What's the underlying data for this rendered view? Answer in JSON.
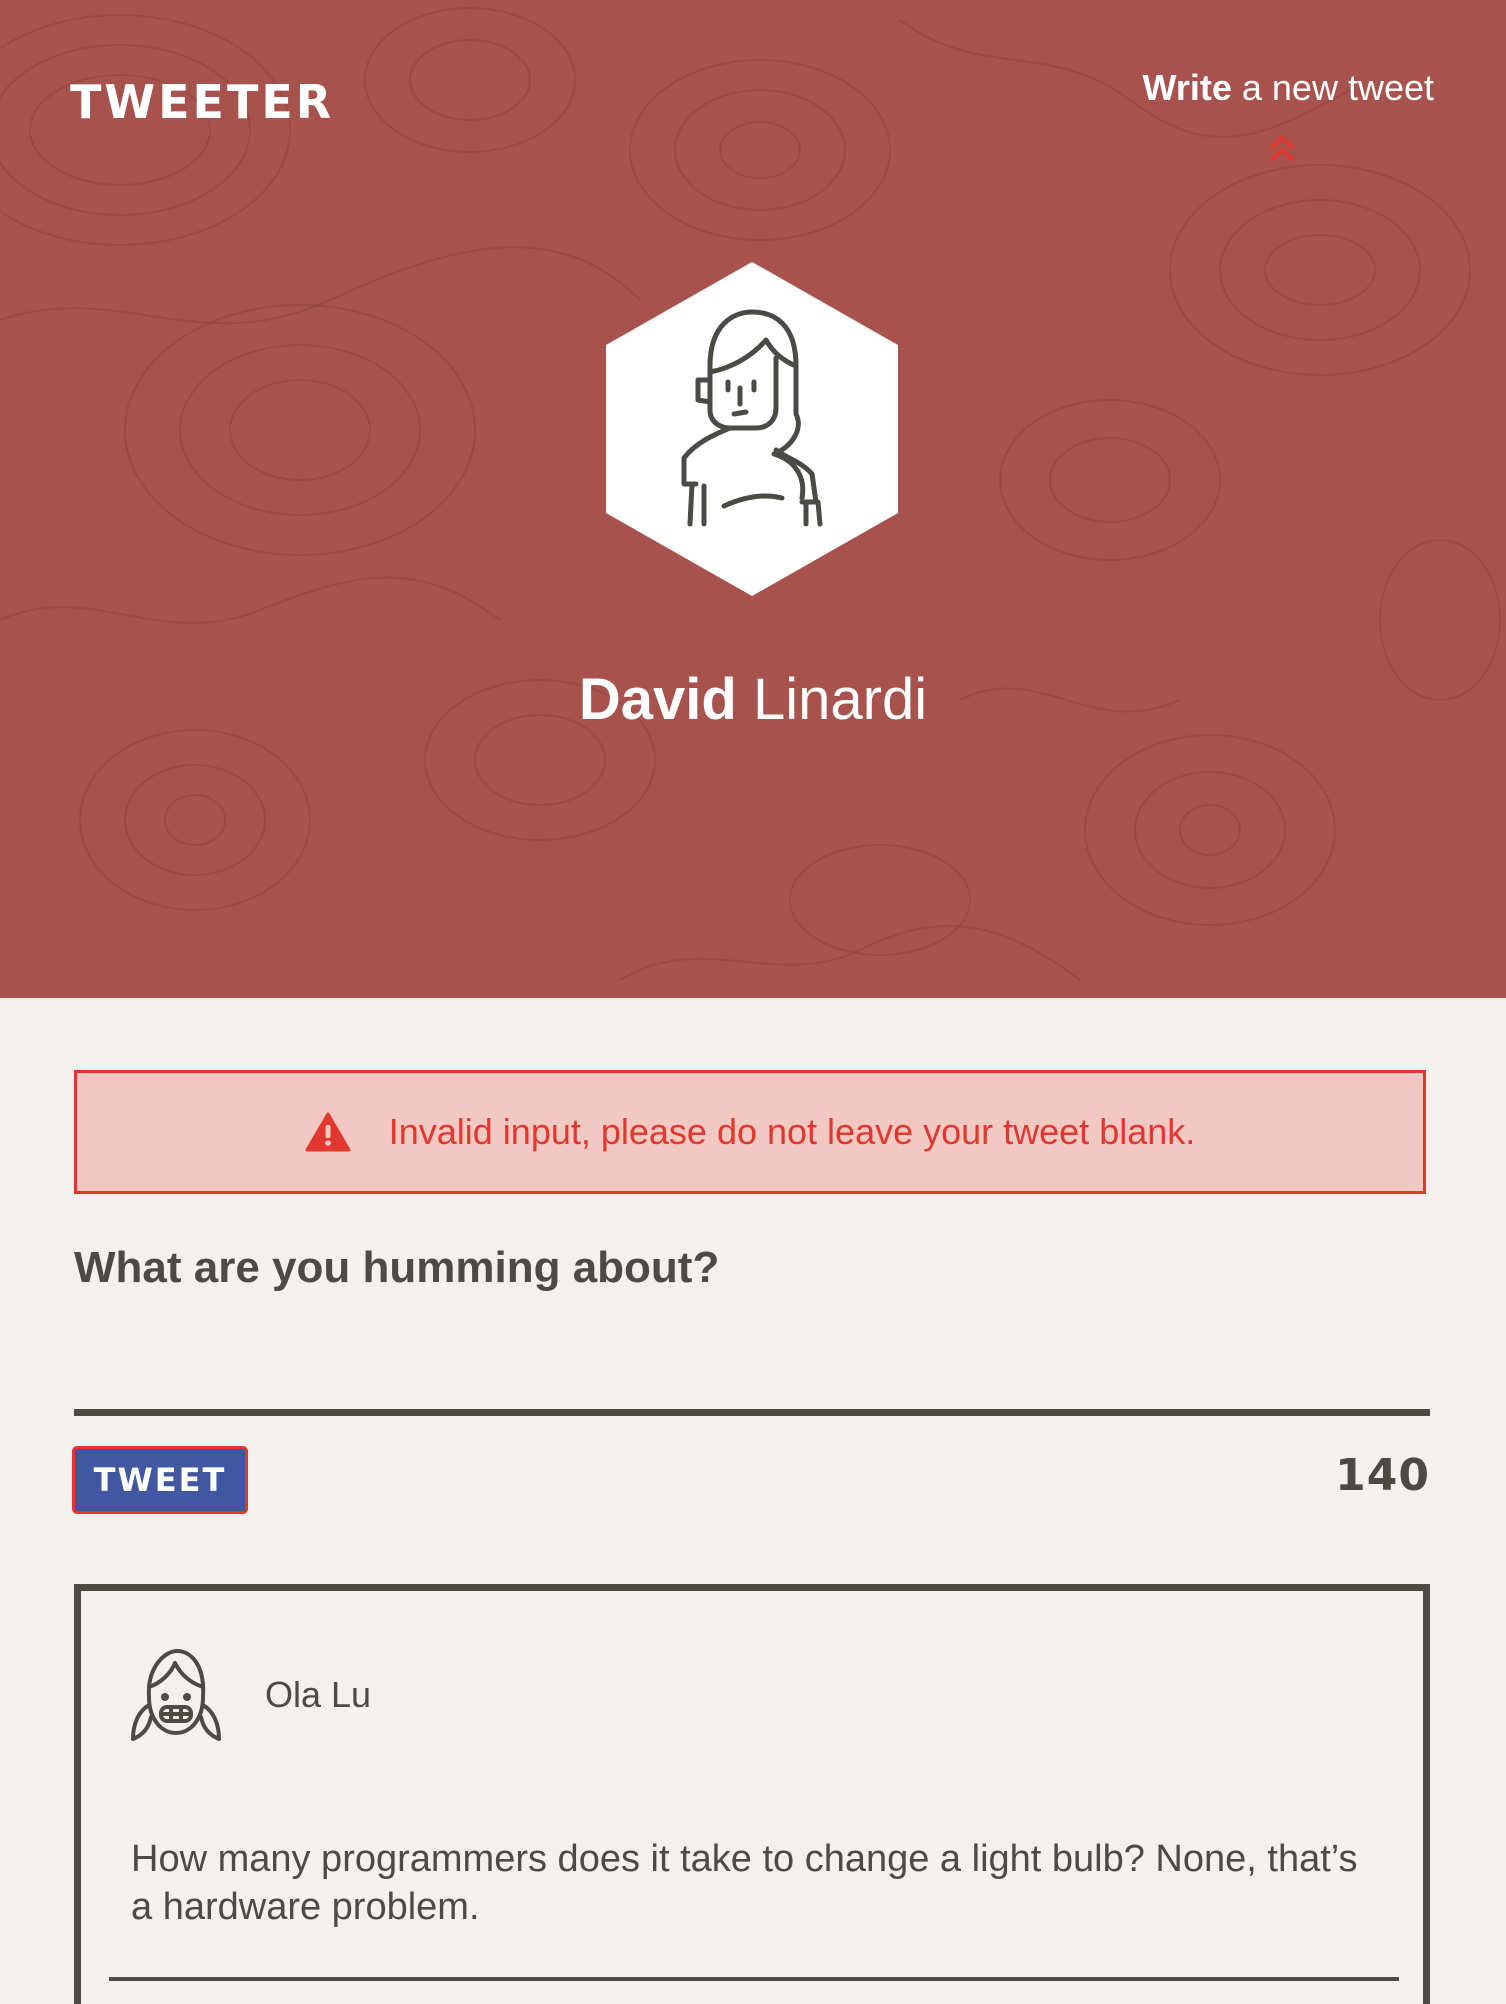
{
  "app": {
    "brand": "TWEETER",
    "compose_link": {
      "strong": "Write",
      "rest": " a new tweet"
    }
  },
  "profile": {
    "first_name": "David",
    "last_name": "Linardi",
    "avatar_icon": "woman-avatar-icon"
  },
  "alert": {
    "icon": "warning-icon",
    "message": "Invalid input, please do not leave your tweet blank."
  },
  "composer": {
    "label": "What are you humming about?",
    "value": "",
    "button_label": "TWEET",
    "counter": "140"
  },
  "tweets": [
    {
      "author": "Ola Lu",
      "avatar_icon": "girl-avatar-icon",
      "text": "How many programmers does it take to change a light bulb? None, that’s a hardware problem."
    }
  ],
  "colors": {
    "header_bg": "#a8524d",
    "page_bg": "#f3f1ed",
    "accent_red": "#e2372e",
    "alert_bg": "#f2c8c3",
    "button_blue": "#4257a2",
    "text_dark": "#4c4a45"
  }
}
